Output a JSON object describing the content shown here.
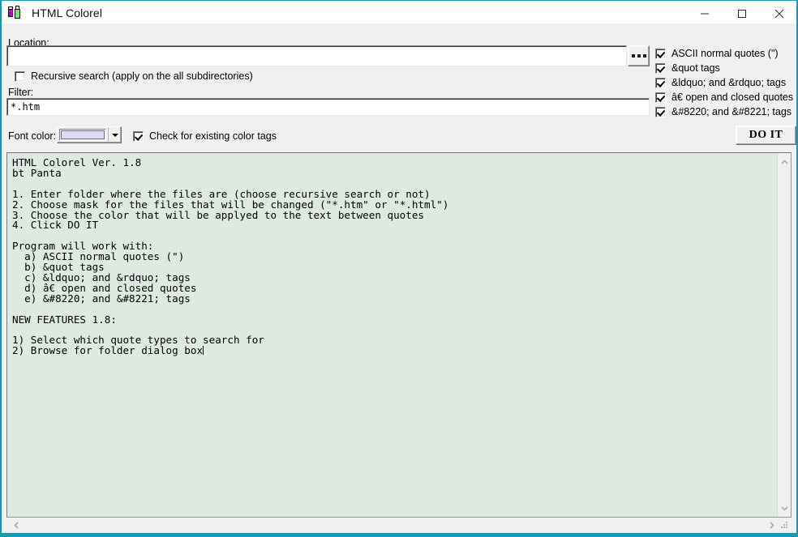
{
  "window": {
    "title": "HTML Colorel",
    "icon": "paint-bottles-icon",
    "border_color": "#1799b4",
    "controls": {
      "minimize": "minimize-button",
      "maximize": "maximize-button",
      "close": "close-button"
    }
  },
  "form": {
    "location_label": "Location:",
    "location_value": "",
    "location_placeholder": "",
    "browse_button_label": "...",
    "recursive": {
      "label": "Recursive search (apply on the all subdirectories)",
      "checked": false
    },
    "filter_label": "Filter:",
    "filter_value": "*.htm",
    "font_color_label": "Font color:",
    "font_color_value": "#dcdcee",
    "check_existing": {
      "label": "Check for existing color tags",
      "checked": true
    },
    "do_it_label": "DO IT"
  },
  "quote_options": [
    {
      "label": "ASCII normal quotes (\")",
      "checked": true
    },
    {
      "label": "&quot tags",
      "checked": true
    },
    {
      "label": "&ldquo; and &rdquo; tags",
      "checked": true
    },
    {
      "label": "â€ open and closed quotes",
      "checked": true
    },
    {
      "label": "&#8220; and &#8221; tags",
      "checked": true
    }
  ],
  "editor": {
    "background_color": "#dde9e1",
    "content": "HTML Colorel Ver. 1.8\nbt Panta\n\n1. Enter folder where the files are (choose recursive search or not)\n2. Choose mask for the files that will be changed (\"*.htm\" or \"*.html\")\n3. Choose the color that will be applyed to the text between quotes\n4. Click DO IT\n\nProgram will work with:\n  a) ASCII normal quotes (\")\n  b) &quot tags\n  c) &ldquo; and &rdquo; tags\n  d) â€ open and closed quotes\n  e) &#8220; and &#8221; tags\n\nNEW FEATURES 1.8:\n\n1) Select which quote types to search for\n2) Browse for folder dialog box"
  },
  "scrollbars": {
    "vertical_up": "scroll-up-arrow",
    "vertical_down": "scroll-down-arrow",
    "horizontal_left": "scroll-left-arrow",
    "horizontal_right": "scroll-right-arrow"
  }
}
